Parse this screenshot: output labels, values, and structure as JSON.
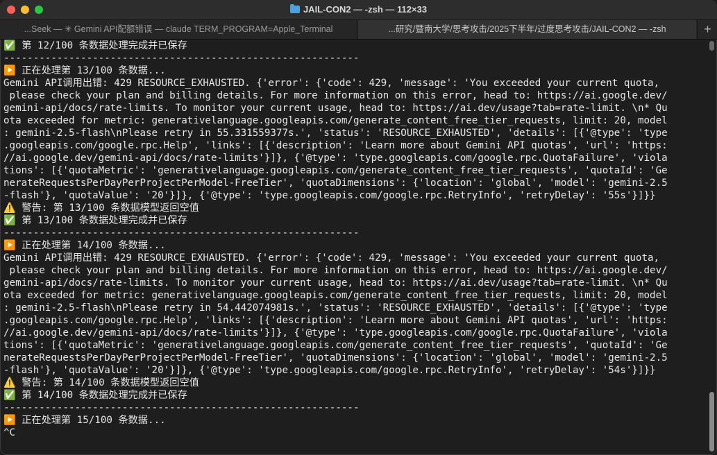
{
  "window": {
    "title": "JAIL-CON2 — -zsh — 112×33",
    "icon": "folder-icon"
  },
  "tabs": [
    {
      "label": "...Seek — ✳ Gemini API配额错误 — claude TERM_PROGRAM=Apple_Terminal"
    },
    {
      "label": "...研究/暨南大学/思考攻击/2025下半年/过度思考攻击/JAIL-CON2 — -zsh"
    }
  ],
  "tab_add_label": "+",
  "colors": {
    "background": "#1e1e1e",
    "text": "#e6e6e6",
    "close": "#ff5f57",
    "minimize": "#febc2e",
    "maximize": "#28c840"
  },
  "terminal_lines": [
    "✅ 第 12/100 条数据处理完成并已保存",
    "------------------------------------------------------------",
    "▶️ 正在处理第 13/100 条数据...",
    "Gemini API调用出错: 429 RESOURCE_EXHAUSTED. {'error': {'code': 429, 'message': 'You exceeded your current quota,",
    " please check your plan and billing details. For more information on this error, head to: https://ai.google.dev/",
    "gemini-api/docs/rate-limits. To monitor your current usage, head to: https://ai.dev/usage?tab=rate-limit. \\n* Qu",
    "ota exceeded for metric: generativelanguage.googleapis.com/generate_content_free_tier_requests, limit: 20, model",
    ": gemini-2.5-flash\\nPlease retry in 55.331559377s.', 'status': 'RESOURCE_EXHAUSTED', 'details': [{'@type': 'type",
    ".googleapis.com/google.rpc.Help', 'links': [{'description': 'Learn more about Gemini API quotas', 'url': 'https:",
    "//ai.google.dev/gemini-api/docs/rate-limits'}]}, {'@type': 'type.googleapis.com/google.rpc.QuotaFailure', 'viola",
    "tions': [{'quotaMetric': 'generativelanguage.googleapis.com/generate_content_free_tier_requests', 'quotaId': 'Ge",
    "nerateRequestsPerDayPerProjectPerModel-FreeTier', 'quotaDimensions': {'location': 'global', 'model': 'gemini-2.5",
    "-flash'}, 'quotaValue': '20'}]}, {'@type': 'type.googleapis.com/google.rpc.RetryInfo', 'retryDelay': '55s'}]}}",
    "⚠️ 警告: 第 13/100 条数据模型返回空值",
    "✅ 第 13/100 条数据处理完成并已保存",
    "------------------------------------------------------------",
    "▶️ 正在处理第 14/100 条数据...",
    "Gemini API调用出错: 429 RESOURCE_EXHAUSTED. {'error': {'code': 429, 'message': 'You exceeded your current quota,",
    " please check your plan and billing details. For more information on this error, head to: https://ai.google.dev/",
    "gemini-api/docs/rate-limits. To monitor your current usage, head to: https://ai.dev/usage?tab=rate-limit. \\n* Qu",
    "ota exceeded for metric: generativelanguage.googleapis.com/generate_content_free_tier_requests, limit: 20, model",
    ": gemini-2.5-flash\\nPlease retry in 54.442074981s.', 'status': 'RESOURCE_EXHAUSTED', 'details': [{'@type': 'type",
    ".googleapis.com/google.rpc.Help', 'links': [{'description': 'Learn more about Gemini API quotas', 'url': 'https:",
    "//ai.google.dev/gemini-api/docs/rate-limits'}]}, {'@type': 'type.googleapis.com/google.rpc.QuotaFailure', 'viola",
    "tions': [{'quotaMetric': 'generativelanguage.googleapis.com/generate_content_free_tier_requests', 'quotaId': 'Ge",
    "nerateRequestsPerDayPerProjectPerModel-FreeTier', 'quotaDimensions': {'location': 'global', 'model': 'gemini-2.5",
    "-flash'}, 'quotaValue': '20'}]}, {'@type': 'type.googleapis.com/google.rpc.RetryInfo', 'retryDelay': '54s'}]}}",
    "⚠️ 警告: 第 14/100 条数据模型返回空值",
    "✅ 第 14/100 条数据处理完成并已保存",
    "------------------------------------------------------------",
    "▶️ 正在处理第 15/100 条数据...",
    "^C"
  ]
}
